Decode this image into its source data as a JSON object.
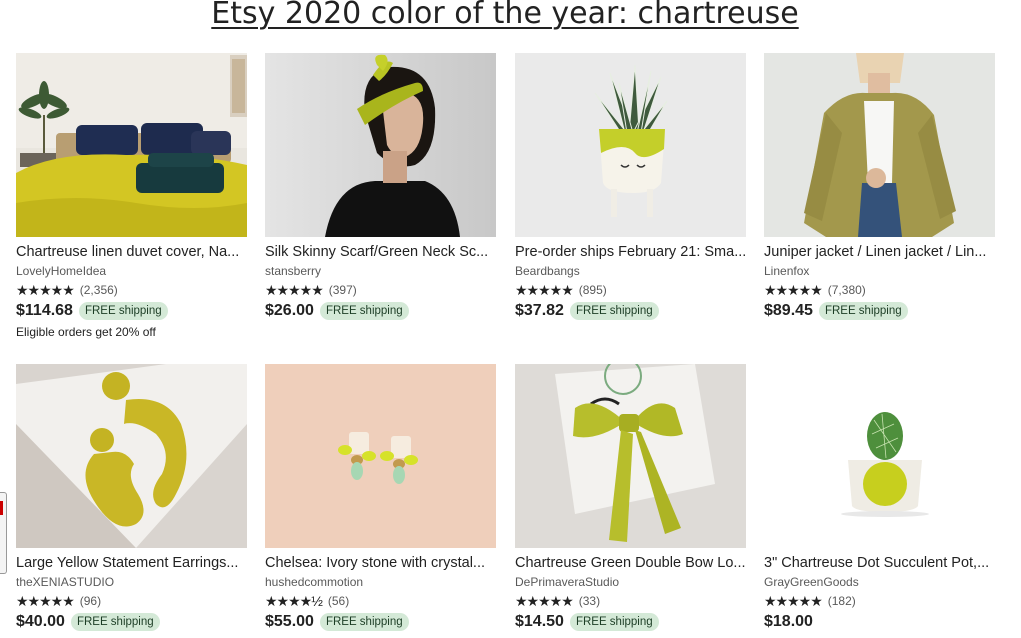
{
  "page": {
    "title": "Etsy 2020 color of the year: chartreuse"
  },
  "colors": {
    "accent": "#b7c21c",
    "badge_bg": "#d4e9d7",
    "badge_text": "#1c3d25"
  },
  "listings": [
    {
      "name": "Chartreuse linen duvet cover, Na...",
      "shop": "LovelyHomeIdea",
      "stars": "★★★★★",
      "reviews": "(2,356)",
      "price": "$114.68",
      "badge": "FREE shipping",
      "promo": "Eligible orders get 20% off"
    },
    {
      "name": "Silk Skinny Scarf/Green Neck Sc...",
      "shop": "stansberry",
      "stars": "★★★★★",
      "reviews": "(397)",
      "price": "$26.00",
      "badge": "FREE shipping"
    },
    {
      "name": "Pre-order ships February 21: Sma...",
      "shop": "Beardbangs",
      "stars": "★★★★★",
      "reviews": "(895)",
      "price": "$37.82",
      "badge": "FREE shipping"
    },
    {
      "name": "Juniper jacket / Linen jacket / Lin...",
      "shop": "Linenfox",
      "stars": "★★★★★",
      "reviews": "(7,380)",
      "price": "$89.45",
      "badge": "FREE shipping"
    },
    {
      "name": "Large Yellow Statement Earrings...",
      "shop": "theXENIASTUDIO",
      "stars": "★★★★★",
      "reviews": "(96)",
      "price": "$40.00",
      "badge": "FREE shipping"
    },
    {
      "name": "Chelsea: Ivory stone with crystal...",
      "shop": "hushedcommotion",
      "stars": "★★★★½",
      "reviews": "(56)",
      "price": "$55.00",
      "badge": "FREE shipping"
    },
    {
      "name": "Chartreuse Green Double Bow Lo...",
      "shop": "DePrimaveraStudio",
      "stars": "★★★★★",
      "reviews": "(33)",
      "price": "$14.50",
      "badge": "FREE shipping"
    },
    {
      "name": "3\" Chartreuse Dot Succulent Pot,...",
      "shop": "GrayGreenGoods",
      "stars": "★★★★★",
      "reviews": "(182)",
      "price": "$18.00"
    }
  ]
}
